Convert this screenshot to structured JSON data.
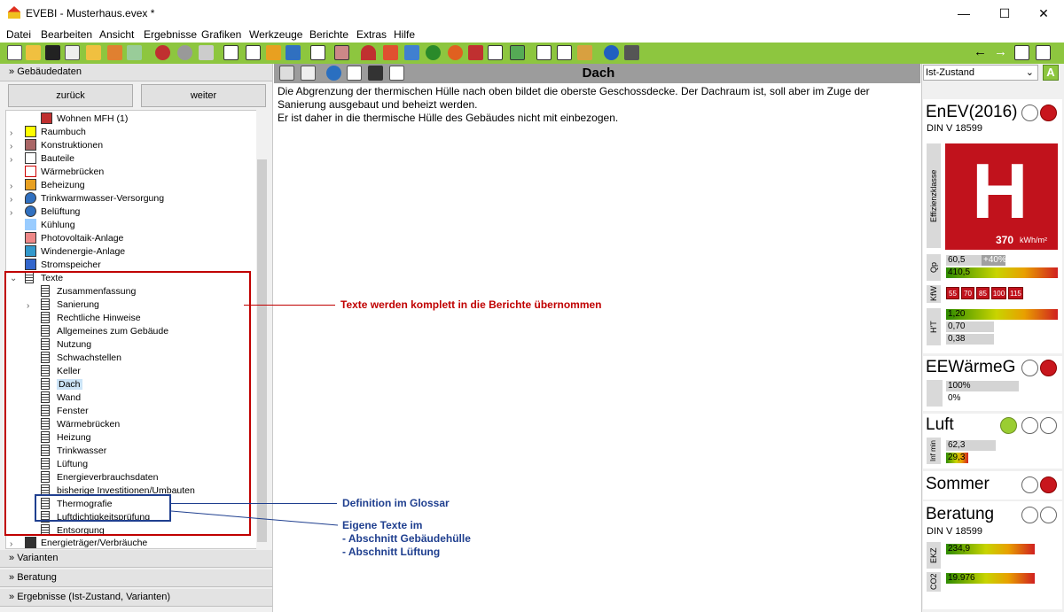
{
  "window": {
    "title": "EVEBI - Musterhaus.evex *",
    "minimize": "—",
    "maximize": "☐",
    "close": "✕"
  },
  "menu": [
    "Datei",
    "Bearbeiten",
    "Ansicht",
    "Ergebnisse",
    "Grafiken",
    "Werkzeuge",
    "Berichte",
    "Extras",
    "Hilfe"
  ],
  "toolbar": {
    "back_arrow": "←",
    "forward_arrow": "→"
  },
  "left": {
    "section_title": "Gebäudedaten",
    "back_button": "zurück",
    "next_button": "weiter",
    "tree": [
      "Wohnen MFH (1)",
      "Raumbuch",
      "Konstruktionen",
      "Bauteile",
      "Wärmebrücken",
      "Beheizung",
      "Trinkwarmwasser-Versorgung",
      "Belüftung",
      "Kühlung",
      "Photovoltaik-Anlage",
      "Windenergie-Anlage",
      "Stromspeicher",
      "Texte",
      "Zusammenfassung",
      "Sanierung",
      "Rechtliche Hinweise",
      "Allgemeines zum Gebäude",
      "Nutzung",
      "Schwachstellen",
      "Keller",
      "Dach",
      "Wand",
      "Fenster",
      "Wärmebrücken",
      "Heizung",
      "Trinkwasser",
      "Lüftung",
      "Energieverbrauchsdaten",
      "bisherige Investitionen/Umbauten",
      "Thermografie",
      "Luftdichtigkeitsprüfung",
      "Entsorgung",
      "Energieträger/Verbräuche"
    ],
    "sections": [
      "Varianten",
      "Beratung",
      "Ergebnisse (Ist-Zustand, Varianten)"
    ]
  },
  "main": {
    "title": "Dach",
    "text1": "Die Abgrenzung der thermischen Hülle nach oben bildet die oberste Geschossdecke. Der Dachraum ist, soll aber im Zuge der Sanierung ausgebaut und beheizt werden.",
    "text2": "Er ist daher in die thermische Hülle des Gebäudes nicht mit einbezogen."
  },
  "annotations": {
    "red": "Texte werden komplett in die Berichte übernommen",
    "glossar": "Definition im Glossar",
    "own1": "Eigene Texte im",
    "own2": "- Abschnitt Gebäudehülle",
    "own3": "- Abschnitt Lüftung",
    "color_red": "#c00000",
    "color_blue": "#1f3f8f"
  },
  "right": {
    "dropdown": "Ist-Zustand",
    "a_badge": "A",
    "enev_title": "EnEV(2016)",
    "enev_sub": "DIN V 18599",
    "effizienz_label": "Effizienzklasse",
    "class_letter": "H",
    "class_value": "370",
    "class_unit": "kWh/m²",
    "qp_label": "Qp",
    "qp_val1": "60,5",
    "qp_badge": "+40%",
    "qp_val2": "410,5",
    "kw_label": "KfW",
    "kw_values": [
      "55",
      "70",
      "85",
      "100",
      "115"
    ],
    "ht_label": "H'T",
    "ht_vals": [
      "1,20",
      "0,70",
      "0,38"
    ],
    "ee_title": "EEWärmeG",
    "ee_vals": [
      "100%",
      "0%"
    ],
    "luft_title": "Luft",
    "inf_label": "Inf min",
    "luft_vals": [
      "62,3",
      "29,3"
    ],
    "sommer_title": "Sommer",
    "beratung_title": "Beratung",
    "beratung_sub": "DIN V 18599",
    "ekz_label": "EKZ",
    "ekz_val": "234,9",
    "co2_label": "CO2",
    "co2_val": "19.976"
  }
}
